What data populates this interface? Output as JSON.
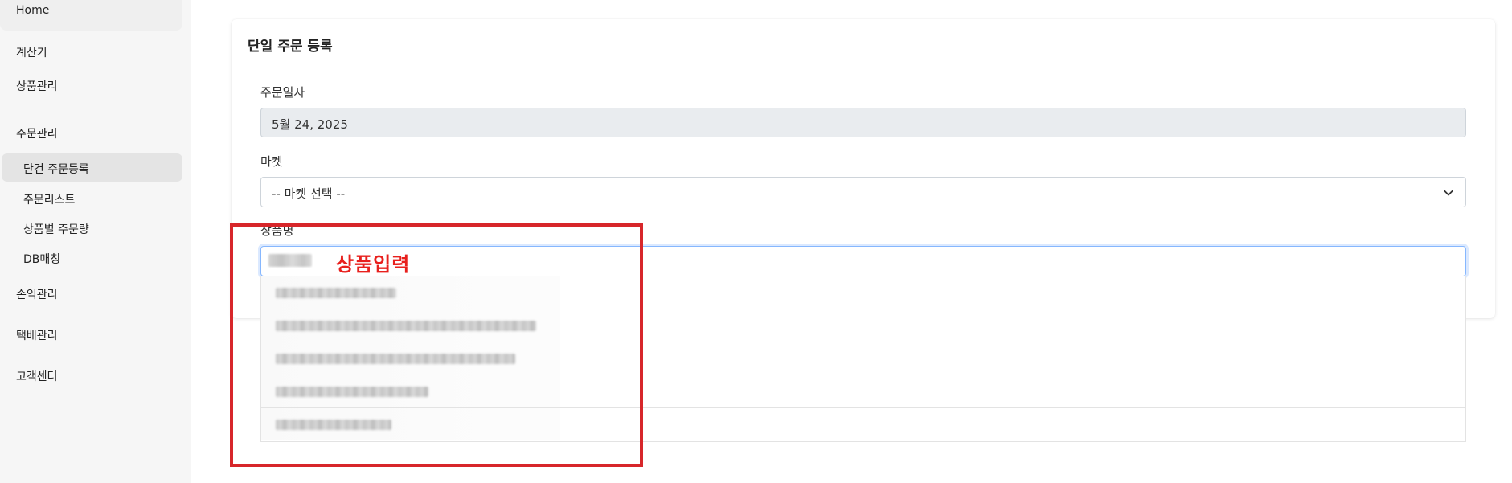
{
  "sidebar": {
    "home": "Home",
    "items": [
      {
        "label": "계산기"
      },
      {
        "label": "상품관리"
      },
      {
        "label": "주문관리"
      },
      {
        "label": "손익관리"
      },
      {
        "label": "택배관리"
      },
      {
        "label": "고객센터"
      }
    ],
    "sub_items": [
      {
        "label": "단건 주문등록",
        "active": true
      },
      {
        "label": "주문리스트"
      },
      {
        "label": "상품별 주문량"
      },
      {
        "label": "DB매칭"
      }
    ]
  },
  "form": {
    "title": "단일 주문 등록",
    "order_date_label": "주문일자",
    "order_date_value": "5월 24, 2025",
    "market_label": "마켓",
    "market_selected": "-- 마켓 선택 --",
    "product_label": "상품명"
  },
  "annotation": {
    "text": "상품입력",
    "color": "#d7262a"
  },
  "colors": {
    "focus_border": "#86b7fe",
    "readonly_bg": "#e9ecef",
    "annotation_text": "#e8201d"
  },
  "icons": {
    "select_chevron": "chevron-down-icon"
  }
}
